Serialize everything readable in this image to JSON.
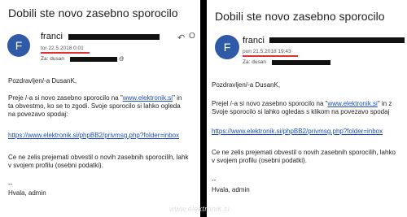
{
  "left": {
    "title": "Dobili ste novo zasebno sporocilo",
    "avatar_letter": "F",
    "sender": "franci",
    "date": "tor 22.5.2018 0:01",
    "to_label": "Za:",
    "to_name": "dusan",
    "to_suffix": "@",
    "greeting": "Pozdravljen/-a DusanK,",
    "p1_pre": "Preje /-a si novo zasebno sporocilo na \"",
    "p1_link": "www.elektronik.si",
    "p1_post": "\" in",
    "p1_line2": "ta obvestmo, ko se to zgodi. Svoje sporocilo si lahko ogleda",
    "p1_line3": "na povezavo spodaj:",
    "url": "https://www.elektronik.si/phpBB2/privmsg.php?folder=inbox",
    "p2_line1": "Ce ne zelis prejemati obvestil o novih zasebnih sporocilih, lahk",
    "p2_line2": "v svojem profilu (osebni podatki).",
    "dashes": "--",
    "sign": "Hvala, admin",
    "reply_icon": "reply-icon"
  },
  "right": {
    "title": "Dobili ste novo zasebno sporocilo",
    "avatar_letter": "F",
    "sender": "franci",
    "date": "pon 21.5.2018 19:43",
    "to_label": "Za:",
    "to_name": "dusan",
    "greeting": "Pozdravljen/-a DusanK,",
    "p1_pre": "Prejel /-a si novo zasebno sporocilo na \"",
    "p1_link": "www.elektronik.si",
    "p1_post": "\" in z",
    "p1_line2": "Svoje sporocilo si lahko ogledas s klikom na povezavo spodaj",
    "url": "https://www.elektronik.si/phpBB2/privmsg.php?folder=inbox",
    "p2_line1": "Ce ne zelis prejemati obvestil o novih zasebnih sporocilih, lahko",
    "p2_line2": "v svojem profilu (osebni podatki).",
    "dashes": "--",
    "sign": "Hvala, admin"
  },
  "watermark": "www.elektronik.si",
  "colors": {
    "avatar": "#2f5aa8",
    "underline": "#d33333",
    "link": "#1b4fb3",
    "divider": "#000000"
  }
}
